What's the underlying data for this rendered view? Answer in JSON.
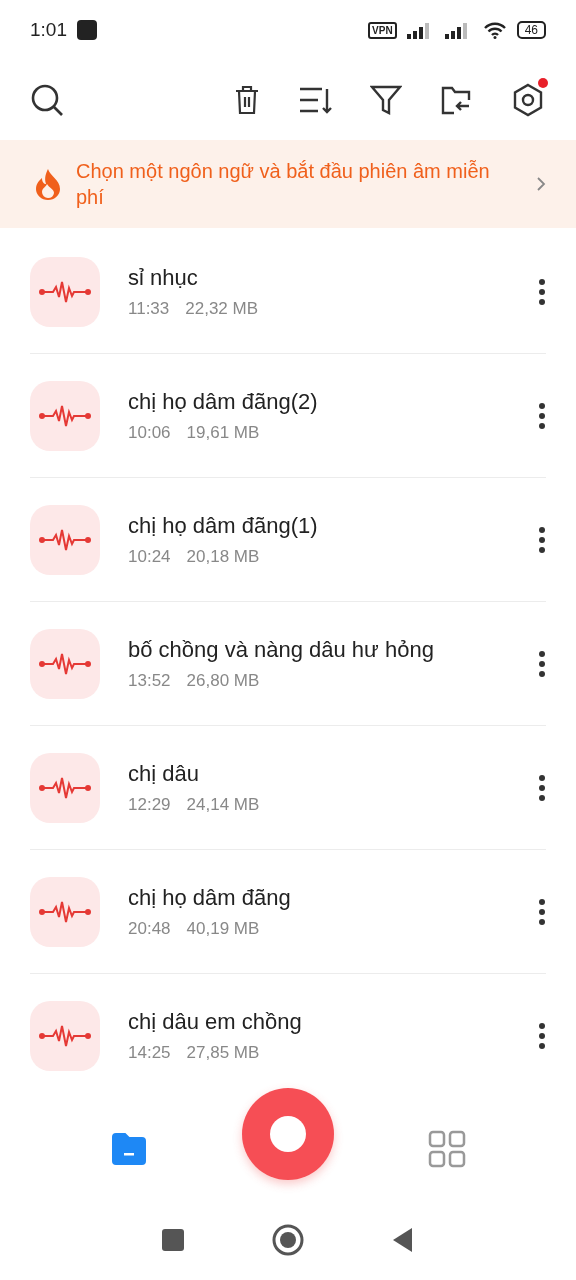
{
  "status_bar": {
    "time": "1:01",
    "vpn": "VPN",
    "battery": "46"
  },
  "toolbar": {
    "settings_badge": true
  },
  "banner": {
    "text": "Chọn một ngôn ngữ và bắt đầu phiên âm miễn phí"
  },
  "recordings": [
    {
      "title": "sỉ nhục",
      "time": "11:33",
      "size": "22,32 MB"
    },
    {
      "title": "chị họ dâm đãng(2)",
      "time": "10:06",
      "size": "19,61 MB"
    },
    {
      "title": "chị họ dâm đãng(1)",
      "time": "10:24",
      "size": "20,18 MB"
    },
    {
      "title": "bố chồng và nàng dâu hư hỏng",
      "time": "13:52",
      "size": "26,80 MB"
    },
    {
      "title": "chị dâu",
      "time": "12:29",
      "size": "24,14 MB"
    },
    {
      "title": "chị họ dâm đãng",
      "time": "20:48",
      "size": "40,19 MB"
    },
    {
      "title": "chị dâu em chồng",
      "time": "14:25",
      "size": "27,85 MB"
    }
  ],
  "bottom_tabs": [
    {
      "kind": "files",
      "selected": true
    },
    {
      "kind": "apps",
      "selected": false
    }
  ]
}
